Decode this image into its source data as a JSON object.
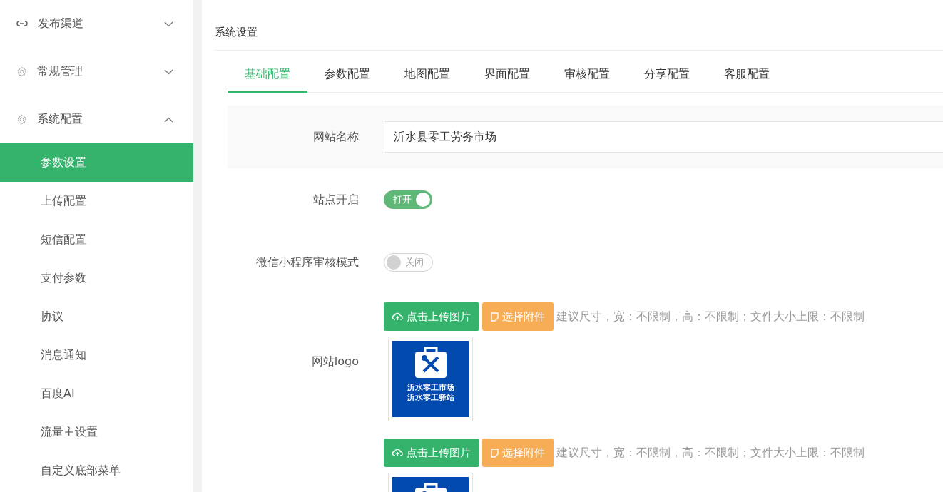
{
  "sidebar": {
    "groups": [
      {
        "label": "发布渠道",
        "kind": "link",
        "expanded": false
      },
      {
        "label": "常规管理",
        "kind": "gear",
        "expanded": false
      },
      {
        "label": "系统配置",
        "kind": "gear",
        "expanded": true,
        "items": [
          {
            "label": "参数设置",
            "selected": true
          },
          {
            "label": "上传配置",
            "selected": false
          },
          {
            "label": "短信配置",
            "selected": false
          },
          {
            "label": "支付参数",
            "selected": false
          },
          {
            "label": "协议",
            "selected": false
          },
          {
            "label": "消息通知",
            "selected": false
          },
          {
            "label": "百度AI",
            "selected": false
          },
          {
            "label": "流量主设置",
            "selected": false
          },
          {
            "label": "自定义底部菜单",
            "selected": false
          }
        ]
      }
    ]
  },
  "panel": {
    "title": "系统设置",
    "tabs": [
      {
        "label": "基础配置",
        "selected": true
      },
      {
        "label": "参数配置",
        "selected": false
      },
      {
        "label": "地图配置",
        "selected": false
      },
      {
        "label": "界面配置",
        "selected": false
      },
      {
        "label": "审核配置",
        "selected": false
      },
      {
        "label": "分享配置",
        "selected": false
      },
      {
        "label": "客服配置",
        "selected": false
      }
    ],
    "fields": [
      {
        "kind": "text",
        "label": "网站名称",
        "value": "沂水县零工劳务市场"
      },
      {
        "kind": "switch",
        "label": "站点开启",
        "on": true,
        "text": "打开"
      },
      {
        "kind": "switch",
        "label": "微信小程序审核模式",
        "on": false,
        "text": "关闭"
      },
      {
        "kind": "image",
        "label": "网站logo",
        "upload_button": "点击上传图片",
        "attach_button": "选择附件",
        "hint": "建议尺寸，宽：不限制，高：不限制；文件大小上限：不限制",
        "preview_lines": [
          "沂水零工市场",
          "沂水零工驿站"
        ]
      },
      {
        "kind": "image",
        "upload_button": "点击上传图片",
        "attach_button": "选择附件",
        "hint": "建议尺寸，宽：不限制，高：不限制；文件大小上限：不限制"
      }
    ]
  }
}
